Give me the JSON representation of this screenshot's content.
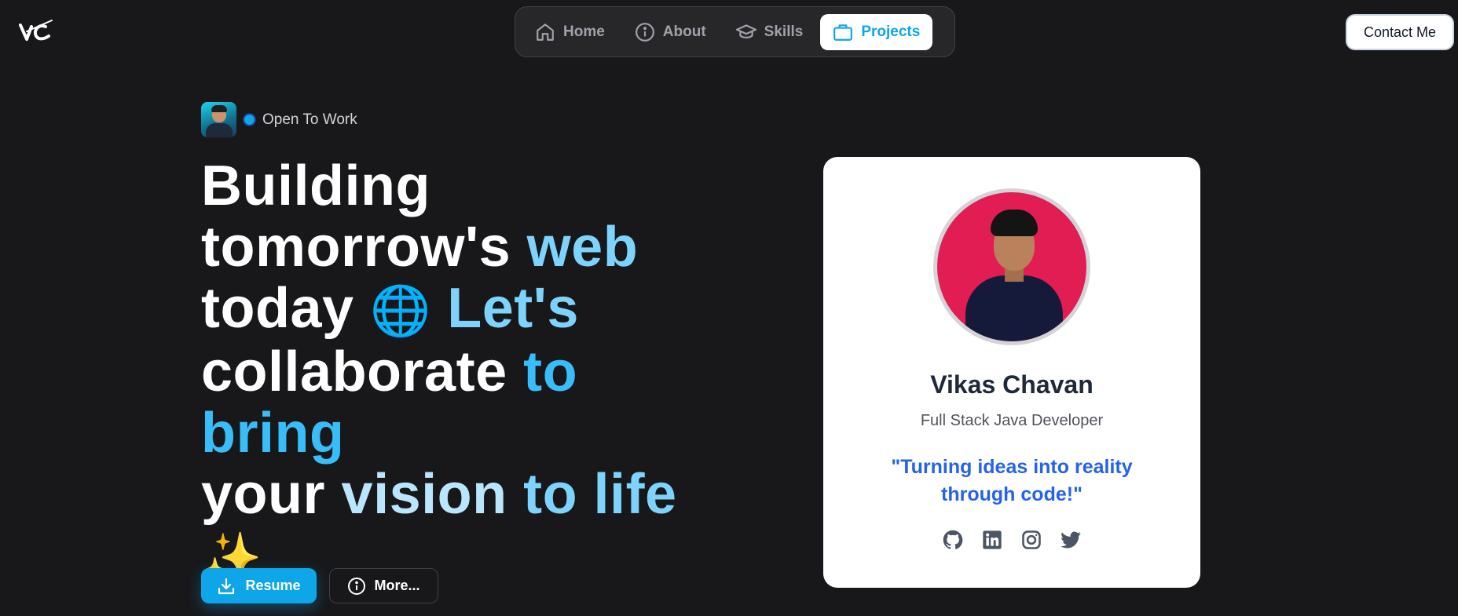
{
  "logo": {
    "text": "VC"
  },
  "nav": {
    "items": [
      {
        "label": "Home",
        "icon": "home-icon",
        "active": false
      },
      {
        "label": "About",
        "icon": "info-icon",
        "active": false
      },
      {
        "label": "Skills",
        "icon": "graduation-cap-icon",
        "active": false
      },
      {
        "label": "Projects",
        "icon": "briefcase-icon",
        "active": true
      }
    ]
  },
  "header": {
    "contact_label": "Contact Me"
  },
  "hero": {
    "status": "Open To Work",
    "headline": {
      "line1": "Building",
      "line2a": "tomorrow's ",
      "line2b": "web",
      "line3a": "today ",
      "line3_emoji": "🌐",
      "line3b": " Let's",
      "line4a": "collaborate ",
      "line4b": "to bring",
      "line5a": "your ",
      "line5b": "vision ",
      "line5c": "to life",
      "line6_emoji": "✨"
    },
    "resume_label": "Resume",
    "more_label": "More..."
  },
  "card": {
    "name": "Vikas Chavan",
    "role": "Full Stack Java Developer",
    "quote": "\"Turning ideas into reality through code!\"",
    "socials": [
      "github-icon",
      "linkedin-icon",
      "instagram-icon",
      "twitter-icon"
    ]
  },
  "colors": {
    "background": "#18181b",
    "accent": "#0ea5e9",
    "quote": "#2563eb",
    "photo_bg": "#e11d54"
  }
}
